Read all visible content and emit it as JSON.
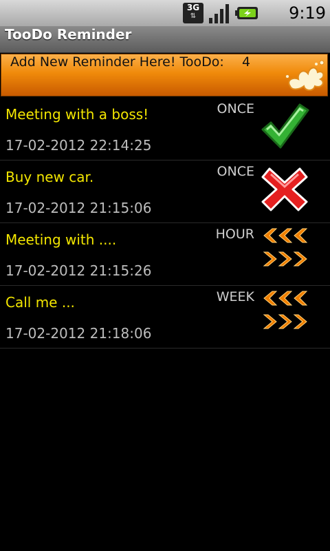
{
  "status_bar": {
    "network": "3G",
    "time": "9:19 PM",
    "icons": [
      "3g-data-icon",
      "signal-icon",
      "battery-charging-icon"
    ]
  },
  "app": {
    "title": "TooDo Reminder"
  },
  "banner": {
    "label": "Add New Reminder Here! TooDo:",
    "count": "4",
    "icon": "splash-icon"
  },
  "reminders": [
    {
      "title": "Meeting with a boss!",
      "date": "17-02-2012 22:14:25",
      "frequency": "ONCE",
      "status": "done",
      "icon": "checkmark-icon"
    },
    {
      "title": "Buy new car.",
      "date": "17-02-2012 21:15:06",
      "frequency": "ONCE",
      "status": "missed",
      "icon": "red-x-icon"
    },
    {
      "title": "Meeting with ....",
      "date": "17-02-2012 21:15:26",
      "frequency": "HOUR",
      "status": "repeating",
      "icon": "repeat-chevrons-icon"
    },
    {
      "title": "Call me ...",
      "date": "17-02-2012 21:18:06",
      "frequency": "WEEK",
      "status": "repeating",
      "icon": "repeat-chevrons-icon"
    }
  ],
  "colors": {
    "banner_orange": "#f08a0a",
    "title_yellow": "#f3e600",
    "date_grey": "#bdbdbd",
    "check_green": "#2fa82f",
    "cross_red": "#e02020",
    "chevron_orange": "#f07f00"
  }
}
